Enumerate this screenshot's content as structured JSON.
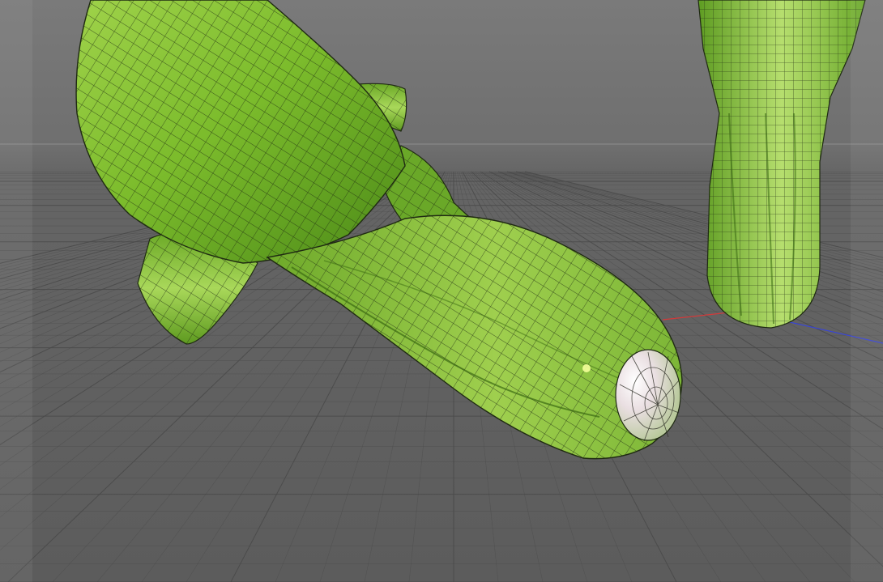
{
  "viewport": {
    "background_top": "#7a7a7a",
    "background_bottom": "#5c5c5c",
    "grid_color": "#4a4a4a",
    "grid_minor_color": "#555555"
  },
  "axes": {
    "x_color": "#d23a3a",
    "z_color": "#3a46d2"
  },
  "material": {
    "skin_light": "#a6d653",
    "skin_mid": "#7fbf2e",
    "skin_dark": "#3f7a12",
    "tip_color": "#e8d8dc",
    "wire_color": "#1f2a12"
  },
  "objects": [
    "cucumber-model-foreground",
    "cucumber-model-background"
  ]
}
